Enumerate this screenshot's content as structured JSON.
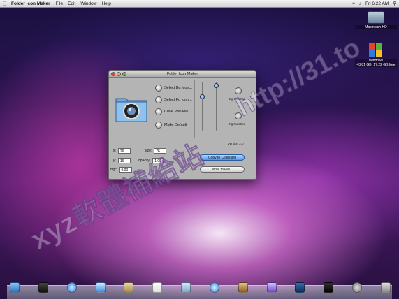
{
  "menubar": {
    "app_name": "Folder Icon Maker",
    "menus": [
      "File",
      "Edit",
      "Window",
      "Help"
    ],
    "clock": "Fri 6:22 AM"
  },
  "desktop": {
    "icons": [
      {
        "label": "Macintosh HD"
      },
      {
        "label": "Windows"
      },
      {
        "label": "43.81 GB, 17.22 GB free"
      }
    ]
  },
  "window": {
    "title": "Folder Icon Maker",
    "options": [
      "Select Bg Icon...",
      "Select Fg Icon...",
      "Clear Preview",
      "Make Default"
    ],
    "labels": {
      "bg_rotation": "Bg Rotation",
      "fg_rotation": "Fg Rotation",
      "version": "Version 2.0",
      "x": "x:",
      "y": "y:",
      "size": "size:",
      "opacity": "opacity:",
      "bg": "Bg°:"
    },
    "fields": {
      "x": "26",
      "y": "16",
      "size": "76",
      "opacity": "1.00",
      "bg": "0.00"
    },
    "buttons": {
      "copy": "Copy to Clipboard",
      "write": "Write to File..."
    }
  },
  "watermark": {
    "line1": "xyz軟體補給站",
    "line2": "http://31.to"
  },
  "dock": {
    "items": [
      "finder",
      "dashboard",
      "safari",
      "ichat",
      "address-book",
      "ical",
      "preview",
      "itunes",
      "iphoto",
      "imovie",
      "photoshop",
      "terminal",
      "system-preferences",
      "trash"
    ]
  },
  "colors": {
    "accent": "#4f94ec",
    "close": "#e0443e",
    "minimize": "#e6b53c",
    "zoom": "#5bbf49"
  }
}
